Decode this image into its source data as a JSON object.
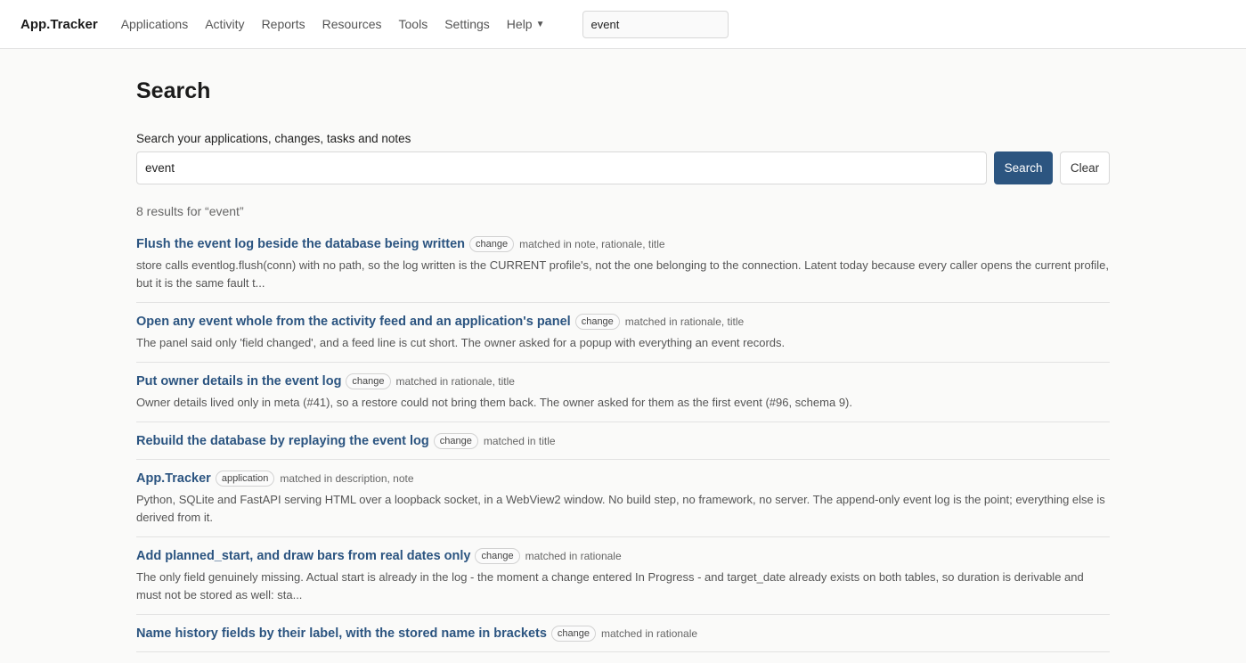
{
  "header": {
    "brand": "App.Tracker",
    "nav": [
      "Applications",
      "Activity",
      "Reports",
      "Resources",
      "Tools",
      "Settings"
    ],
    "help_label": "Help",
    "search_value": "event"
  },
  "page": {
    "title": "Search",
    "search_label": "Search your applications, changes, tasks and notes",
    "search_value": "event",
    "search_button": "Search",
    "clear_button": "Clear",
    "result_count": "8 results for “event”"
  },
  "results": [
    {
      "title": "Flush the event log beside the database being written",
      "tag": "change",
      "matched": "matched in note, rationale, title",
      "snippet": "store calls eventlog.flush(conn) with no path, so the log written is the CURRENT profile's, not the one belonging to the connection. Latent today because every caller opens the current profile, but it is the same fault t..."
    },
    {
      "title": "Open any event whole from the activity feed and an application's panel",
      "tag": "change",
      "matched": "matched in rationale, title",
      "snippet": "The panel said only 'field changed', and a feed line is cut short. The owner asked for a popup with everything an event records."
    },
    {
      "title": "Put owner details in the event log",
      "tag": "change",
      "matched": "matched in rationale, title",
      "snippet": "Owner details lived only in meta (#41), so a restore could not bring them back. The owner asked for them as the first event (#96, schema 9)."
    },
    {
      "title": "Rebuild the database by replaying the event log",
      "tag": "change",
      "matched": "matched in title",
      "snippet": ""
    },
    {
      "title": "App.Tracker",
      "tag": "application",
      "matched": "matched in description, note",
      "snippet": "Python, SQLite and FastAPI serving HTML over a loopback socket, in a WebView2 window. No build step, no framework, no server. The append-only event log is the point; everything else is derived from it."
    },
    {
      "title": "Add planned_start, and draw bars from real dates only",
      "tag": "change",
      "matched": "matched in rationale",
      "snippet": "The only field genuinely missing. Actual start is already in the log - the moment a change entered In Progress - and target_date already exists on both tables, so duration is derivable and must not be stored as well: sta..."
    },
    {
      "title": "Name history fields by their label, with the stored name in brackets",
      "tag": "change",
      "matched": "matched in rationale",
      "snippet": ""
    }
  ]
}
